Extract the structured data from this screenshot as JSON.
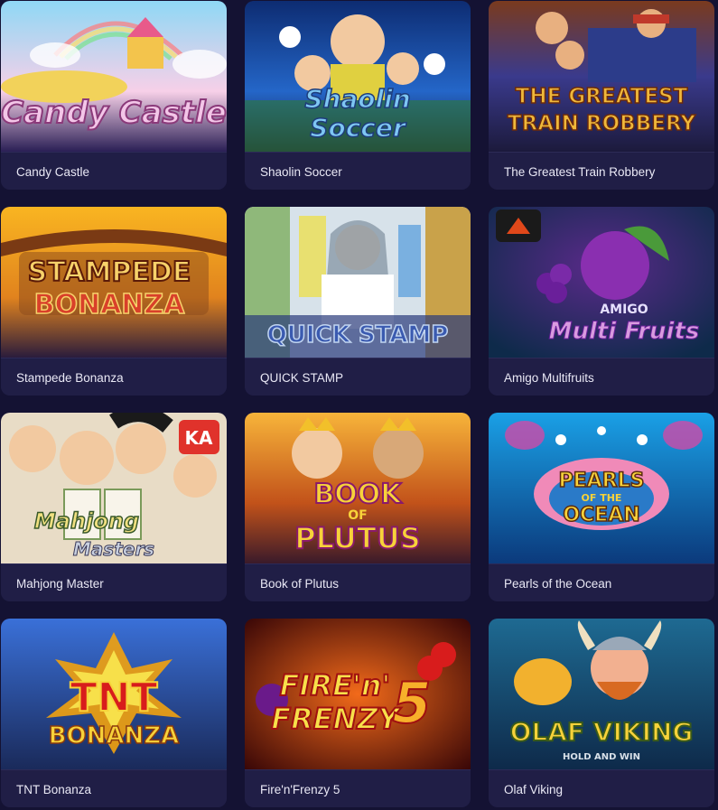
{
  "games": [
    {
      "title": "Candy Castle",
      "logo": "Candy Castle",
      "colors": [
        "#7fd3f2",
        "#f6c2e0",
        "#f4d65c"
      ]
    },
    {
      "title": "Shaolin Soccer",
      "logo_line1": "Shaolin",
      "logo_line2": "Soccer",
      "colors": [
        "#0b2a6e",
        "#1f5fc4",
        "#2e7d32"
      ]
    },
    {
      "title": "The Greatest Train Robbery",
      "logo_line1": "THE GREATEST",
      "logo_line2": "TRAIN ROBBERY",
      "colors": [
        "#8b2e1a",
        "#c9962a",
        "#2a3b7a"
      ]
    },
    {
      "title": "Stampede Bonanza",
      "logo_line1": "STAMPEDE",
      "logo_line2": "BONANZA",
      "colors": [
        "#f9b221",
        "#d45a1a",
        "#6e2c10"
      ]
    },
    {
      "title": "QUICK STAMP",
      "logo": "QUICK STAMP",
      "colors": [
        "#dfe8f0",
        "#5a8cc4",
        "#2a4f8c"
      ]
    },
    {
      "title": "Amigo Multifruits",
      "logo_line1": "AMIGO",
      "logo_line2": "Multi Fruits",
      "colors": [
        "#0f3a5a",
        "#3b1e66",
        "#8a2a9e"
      ]
    },
    {
      "title": "Mahjong Master",
      "logo_line1": "Mahjong",
      "logo_line2": "Masters",
      "badge": "KA",
      "colors": [
        "#f0e6d0",
        "#d9342b",
        "#8a8a8a"
      ]
    },
    {
      "title": "Book of Plutus",
      "logo_line1": "BOOK",
      "logo_line2": "OF",
      "logo_line3": "PLUTUS",
      "colors": [
        "#f7a928",
        "#c25a16",
        "#6a2a0e"
      ]
    },
    {
      "title": "Pearls of the Ocean",
      "logo_line1": "PEARLS",
      "logo_line2": "OF THE",
      "logo_line3": "OCEAN",
      "colors": [
        "#1a8fd6",
        "#0b4f9c",
        "#d84a9a"
      ]
    },
    {
      "title": "TNT Bonanza",
      "logo_line1": "TNT",
      "logo_line2": "BONANZA",
      "colors": [
        "#3a6fd6",
        "#f2a20e",
        "#c21c1c"
      ]
    },
    {
      "title": "Fire'n'Frenzy 5",
      "logo_line1": "FIRE'n'",
      "logo_line2": "FRENZY",
      "logo_num": "5",
      "colors": [
        "#a3140f",
        "#f46a1a",
        "#3a0707"
      ]
    },
    {
      "title": "Olaf Viking",
      "logo_line1": "OLAF VIKING",
      "logo_line2": "HOLD AND WIN",
      "colors": [
        "#1b5e8a",
        "#f2b12e",
        "#d86a22"
      ]
    }
  ]
}
